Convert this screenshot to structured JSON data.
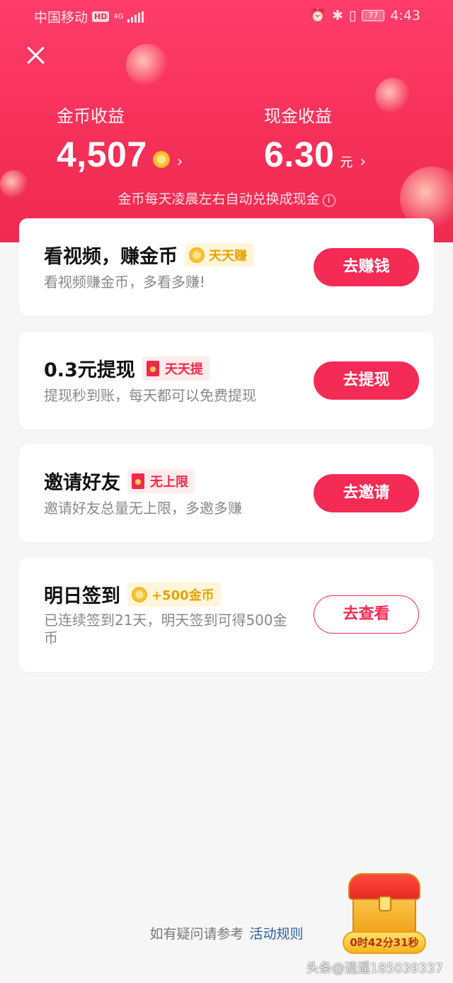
{
  "status_bar": {
    "carrier": "中国移动",
    "hd": "HD",
    "network": "4G",
    "battery": "77",
    "time": "4:43"
  },
  "earnings": {
    "coin_label": "金币收益",
    "coin_value": "4,507",
    "cash_label": "现金收益",
    "cash_value": "6.30",
    "cash_unit": "元",
    "note": "金币每天凌晨左右自动兑换成现金"
  },
  "tasks": [
    {
      "title": "看视频，赚金币",
      "tag": "天天赚",
      "tag_style": "gold",
      "desc": "看视频赚金币，多看多赚!",
      "button": "去赚钱"
    },
    {
      "title": "0.3元提现",
      "tag": "天天提",
      "tag_style": "red",
      "desc": "提现秒到账，每天都可以免费提现",
      "button": "去提现"
    },
    {
      "title": "邀请好友",
      "tag": "无上限",
      "tag_style": "red",
      "desc": "邀请好友总量无上限，多邀多赚",
      "button": "去邀请"
    },
    {
      "title": "明日签到",
      "tag": "+500金币",
      "tag_style": "gold",
      "desc": "已连续签到21天，明天签到可得500金币",
      "button": "去查看"
    }
  ],
  "footer": {
    "text": "如有疑问请参考",
    "link": "活动规则"
  },
  "treasure": {
    "timer": "0时42分31秒"
  },
  "watermark": "头条@逍遥185039337",
  "colors": {
    "primary": "#f42b55",
    "gold": "#e9a200"
  }
}
